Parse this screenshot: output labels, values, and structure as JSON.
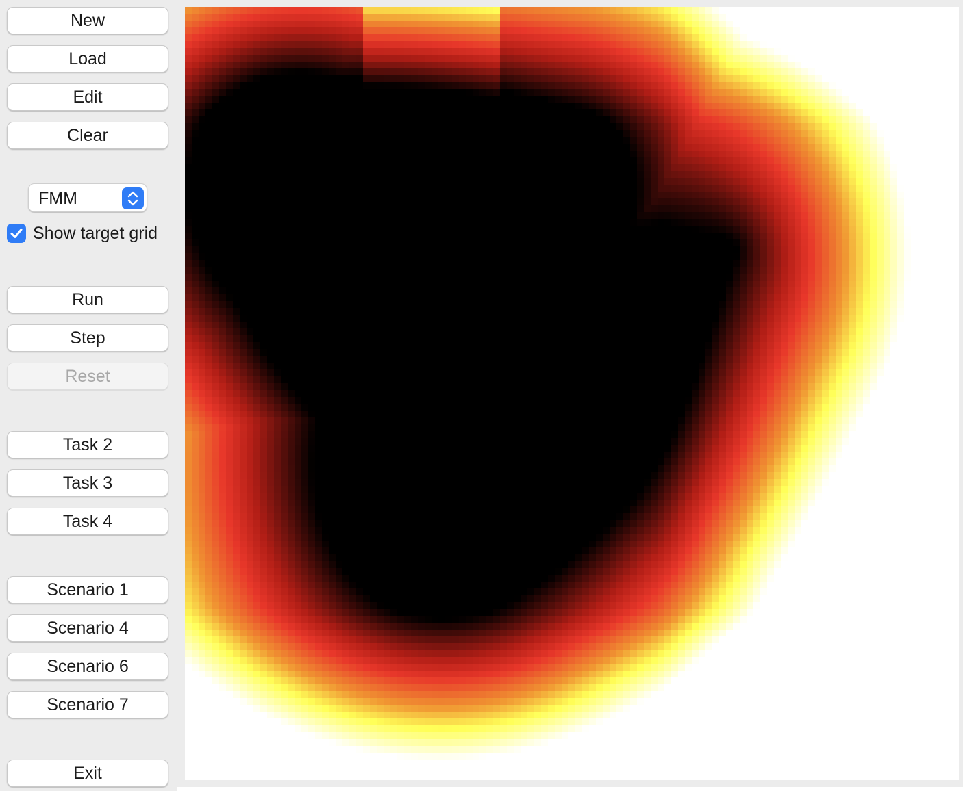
{
  "sidebar": {
    "new_label": "New",
    "load_label": "Load",
    "edit_label": "Edit",
    "clear_label": "Clear",
    "algorithm_select": {
      "value": "FMM"
    },
    "show_target_grid": {
      "label": "Show target grid",
      "checked": true
    },
    "run_label": "Run",
    "step_label": "Step",
    "reset_label": "Reset",
    "reset_disabled": true,
    "tasks": [
      "Task 2",
      "Task 3",
      "Task 4"
    ],
    "scenarios": [
      "Scenario 1",
      "Scenario 4",
      "Scenario 6",
      "Scenario 7"
    ],
    "exit_label": "Exit"
  },
  "colors": {
    "accent": "#2f7cf6",
    "heat_low": "#000000",
    "heat_mid": "#e8372a",
    "heat_high": "#ffff58",
    "heat_max": "#ffffff",
    "obstacle": "#000000"
  },
  "icons": {
    "select_stepper": "chevron-up-down-icon",
    "checkbox": "checkmark-icon"
  }
}
